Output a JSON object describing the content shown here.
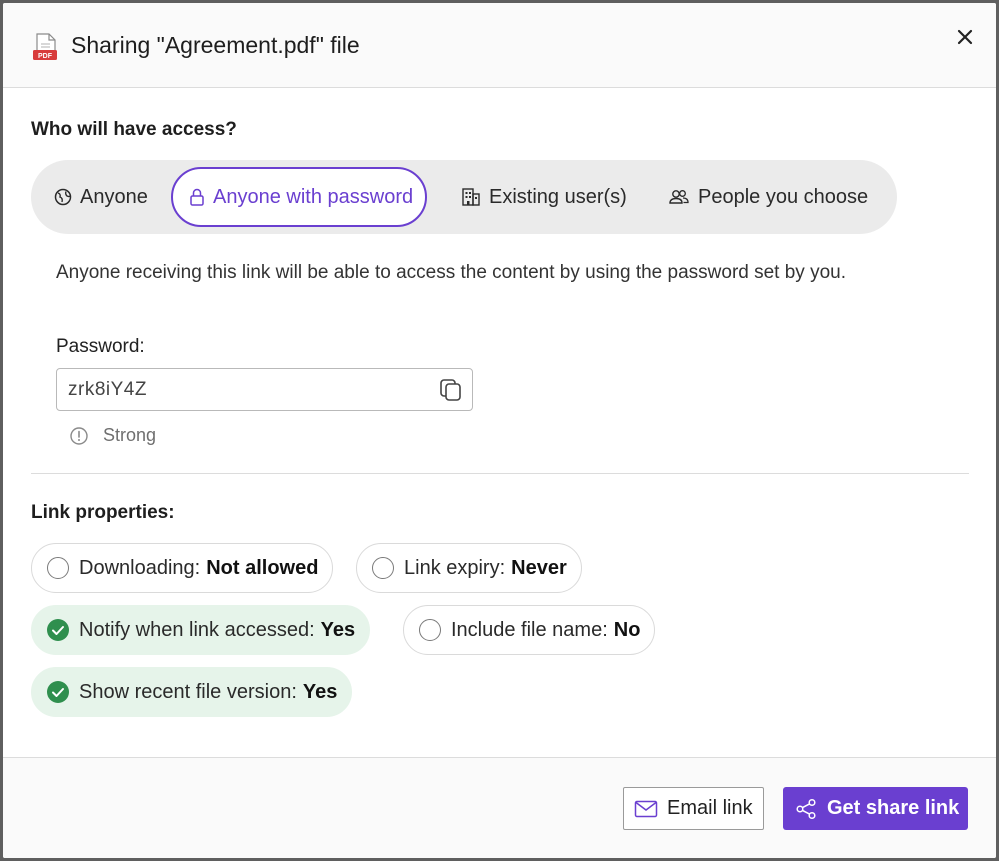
{
  "dialog": {
    "title": "Sharing \"Agreement.pdf\" file",
    "file_icon": "pdf-file-icon",
    "close_icon": "close-icon"
  },
  "access": {
    "heading": "Who will have access?",
    "options": [
      {
        "label": "Anyone",
        "icon": "globe-icon",
        "selected": false
      },
      {
        "label": "Anyone with password",
        "icon": "lock-icon",
        "selected": true
      },
      {
        "label": "Existing user(s)",
        "icon": "building-icon",
        "selected": false
      },
      {
        "label": "People you choose",
        "icon": "people-icon",
        "selected": false
      }
    ],
    "description": "Anyone receiving this link will be able to access the content by using the password set by you.",
    "password_label": "Password:",
    "password_value": "zrk8iY4Z",
    "strength_label": "Strong"
  },
  "link_properties": {
    "heading": "Link properties:",
    "items": [
      {
        "label": "Downloading:",
        "value": "Not allowed",
        "enabled": false
      },
      {
        "label": "Link expiry:",
        "value": "Never",
        "enabled": false
      },
      {
        "label": "Notify when link accessed:",
        "value": "Yes",
        "enabled": true
      },
      {
        "label": "Include file name:",
        "value": "No",
        "enabled": false
      },
      {
        "label": "Show recent file version:",
        "value": "Yes",
        "enabled": true
      }
    ]
  },
  "footer": {
    "email_button": "Email link",
    "share_button": "Get share link"
  },
  "colors": {
    "accent": "#6a3fd0",
    "success": "#2f8f4e",
    "success_bg": "#e6f4ea"
  }
}
